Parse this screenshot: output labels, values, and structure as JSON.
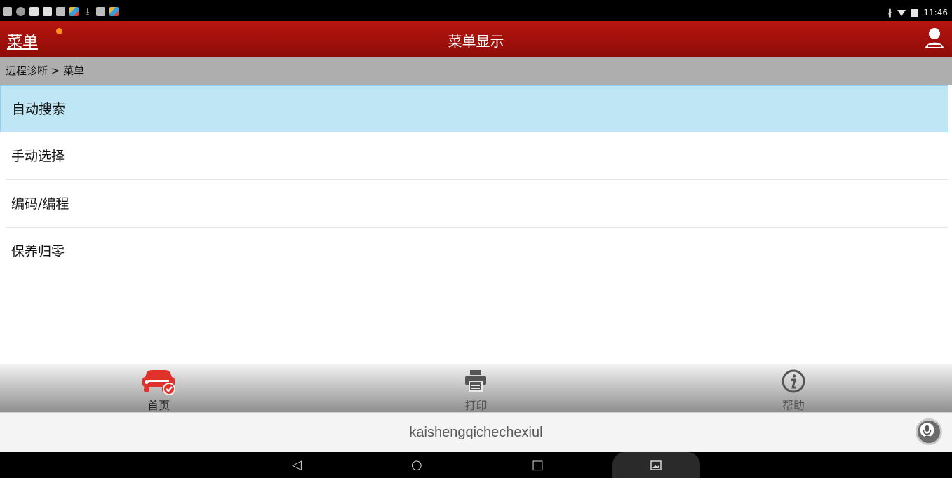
{
  "status_bar": {
    "time": "11:46",
    "bluetooth_icon": "bluetooth-icon",
    "wifi_icon": "wifi-icon",
    "battery_icon": "battery-icon"
  },
  "header": {
    "menu_label": "菜单",
    "title": "菜单显示",
    "user_icon": "user-icon"
  },
  "breadcrumb": {
    "text": "远程诊断 > 菜单"
  },
  "menu_list": {
    "items": [
      {
        "label": "自动搜索",
        "selected": true
      },
      {
        "label": "手动选择",
        "selected": false
      },
      {
        "label": "编码/编程",
        "selected": false
      },
      {
        "label": "保养归零",
        "selected": false
      }
    ]
  },
  "bottom_nav": {
    "tabs": [
      {
        "label": "首页",
        "icon": "car-home-icon",
        "active": true
      },
      {
        "label": "打印",
        "icon": "printer-icon",
        "active": false
      },
      {
        "label": "帮助",
        "icon": "info-icon",
        "active": false
      }
    ]
  },
  "search_bar": {
    "text": "kaishengqichechexiul",
    "icon": "microphone-icon"
  },
  "colors": {
    "header_red": "#a3110c",
    "selected_row": "#bfe6f5",
    "accent_red": "#e0322a"
  }
}
